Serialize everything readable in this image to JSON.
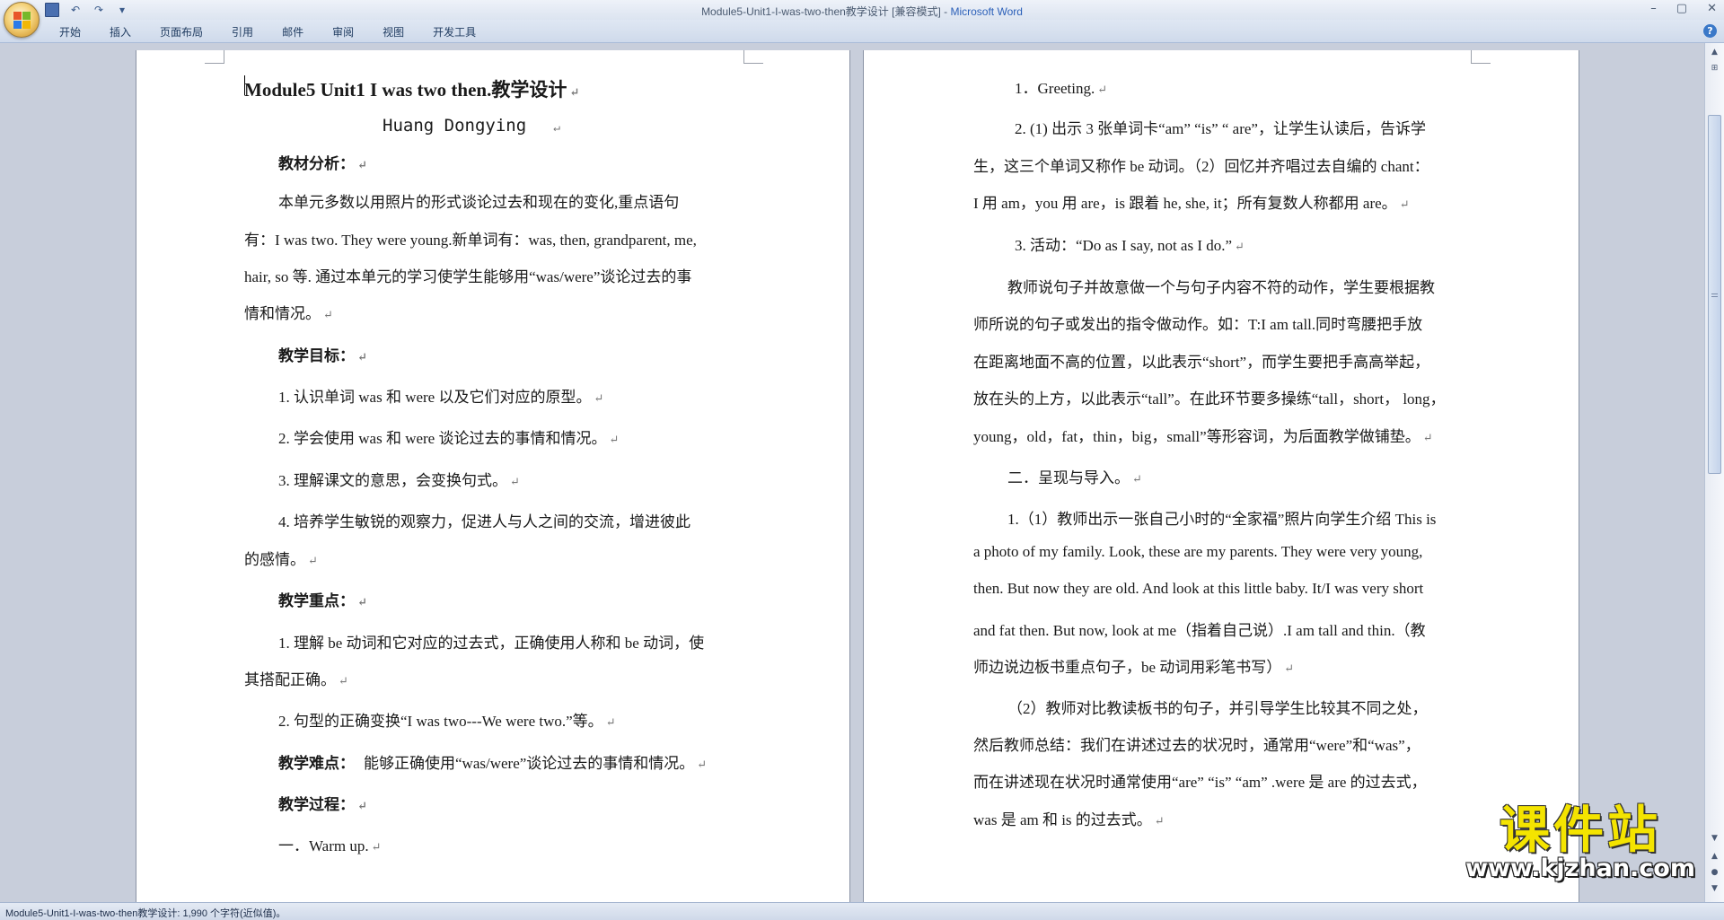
{
  "window": {
    "title_doc": "Module5-Unit1-I-was-two-then教学设计 [兼容模式] - ",
    "title_app": "Microsoft Word",
    "minimize": "–",
    "maximize": "▢",
    "close": "✕"
  },
  "qat": {
    "undo": "↶",
    "redo": "↷",
    "more": "▾"
  },
  "ribbon": {
    "tabs": [
      "开始",
      "插入",
      "页面布局",
      "引用",
      "邮件",
      "审阅",
      "视图",
      "开发工具"
    ],
    "help": "?"
  },
  "left_page": {
    "title": "Module5    Unit1 I was two then.教学设计",
    "author": "Huang Dongying",
    "lines": [
      "教材分析：",
      "本单元多数以用照片的形式谈论过去和现在的变化,重点语句",
      "有：I was two. They were young.新单词有：was, then, grandparent, me,",
      "hair, so 等. 通过本单元的学习使学生能够用“was/were”谈论过去的事",
      "情和情况。",
      "教学目标：",
      "1. 认识单词 was 和 were 以及它们对应的原型。",
      "2. 学会使用 was 和 were 谈论过去的事情和情况。",
      "3. 理解课文的意思，会变换句式。",
      "4. 培养学生敏锐的观察力，促进人与人之间的交流，增进彼此",
      "的感情。",
      "教学重点：",
      "1. 理解 be 动词和它对应的过去式，正确使用人称和 be 动词，使",
      "其搭配正确。",
      "2. 句型的正确变换“I was two---We were two.”等。",
      "教学难点：",
      "能够正确使用“was/were”谈论过去的事情和情况。",
      "教学过程：",
      "一．Warm up."
    ]
  },
  "right_page": {
    "lines": [
      "1．Greeting.",
      "2. (1) 出示 3 张单词卡“am” “is” “ are”，让学生认读后，告诉学",
      "生，这三个单词又称作 be 动词。（2）回忆并齐唱过去自编的 chant：",
      "I 用 am，you 用 are，is 跟着 he, she, it；所有复数人称都用 are。",
      "3. 活动：“Do as I say, not as I do.”",
      "教师说句子并故意做一个与句子内容不符的动作，学生要根据教",
      "师所说的句子或发出的指令做动作。如：T:I am tall.同时弯腰把手放",
      "在距离地面不高的位置，以此表示“short”，而学生要把手高高举起，",
      "放在头的上方，以此表示“tall”。在此环节要多操练“tall，short， long，",
      "young，old，fat，thin，big，small”等形容词，为后面教学做铺垫。",
      "二．呈现与导入。",
      "1.（1）教师出示一张自己小时的“全家福”照片向学生介绍 This is",
      "a photo of my family. Look, these are my parents. They were very young,",
      "then. But now they are old. And look at this little baby. It/I was very short",
      "and fat then. But now, look at me（指着自己说）.I am tall and thin.（教",
      "师边说边板书重点句子，be 动词用彩笔书写）",
      "（2）教师对比教读板书的句子，并引导学生比较其不同之处，",
      "然后教师总结：我们在讲述过去的状况时，通常用“were”和“was”，",
      "而在讲述现在状况时通常使用“are” “is” “am” .were 是 are 的过去式，",
      "was 是 am 和 is 的过去式。"
    ]
  },
  "paragraph_mark": "↵",
  "scrollbar": {
    "up": "▲",
    "down": "▼",
    "prev_page": "▲",
    "next_page": "▼",
    "browse": "●"
  },
  "status": {
    "text": "Module5-Unit1-I-was-two-then教学设计: 1,990 个字符(近似值)。"
  },
  "watermark": {
    "title": "课件站",
    "url": "www.kjzhan.com"
  }
}
